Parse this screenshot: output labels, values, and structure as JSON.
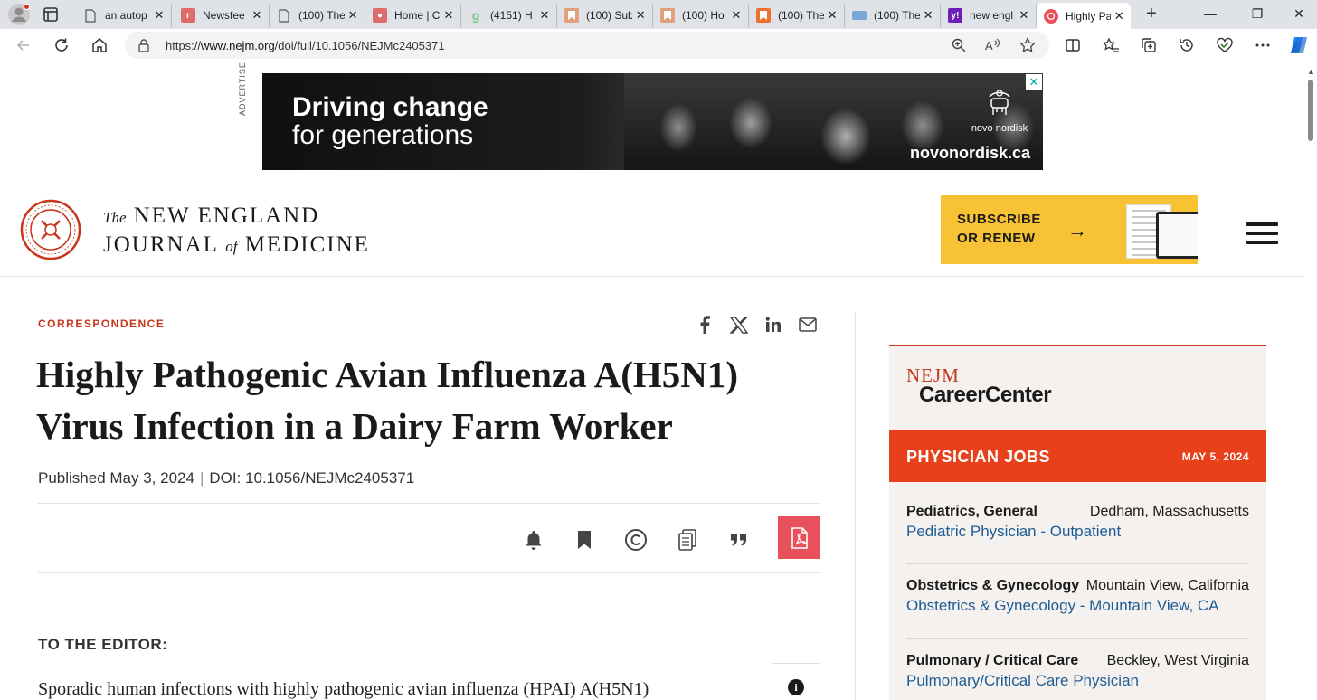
{
  "browser": {
    "tabs": [
      {
        "title": "an autop",
        "favicon": "doc",
        "color": "#ffffff"
      },
      {
        "title": "Newsfee",
        "favicon": "r",
        "color": "#e06b6b"
      },
      {
        "title": "(100) The",
        "favicon": "doc",
        "color": "#ffffff"
      },
      {
        "title": "Home | C",
        "favicon": "user",
        "color": "#e06b6b"
      },
      {
        "title": "(4151) H",
        "favicon": "g",
        "color": "#7bc67e"
      },
      {
        "title": "(100) Sub",
        "favicon": "bookmark",
        "color": "#e0a07b"
      },
      {
        "title": "(100) Ho",
        "favicon": "bookmark",
        "color": "#e0a07b"
      },
      {
        "title": "(100) The",
        "favicon": "bookmark",
        "color": "#f07030"
      },
      {
        "title": "(100) The",
        "favicon": "site",
        "color": "#7aa7d8"
      },
      {
        "title": "new engl",
        "favicon": "y!",
        "color": "#6b1fb8"
      },
      {
        "title": "Highly Pa",
        "favicon": "nejm",
        "color": "#e8505b",
        "active": true
      }
    ],
    "url_prefix": "https://",
    "url_host": "www.nejm.org",
    "url_path": "/doi/full/10.1056/NEJMc2405371"
  },
  "ad": {
    "label": "ADVERTISEMENT",
    "headline_1": "Driving change",
    "headline_2": "for generations",
    "brand": "novo nordisk",
    "site": "novonordisk.ca",
    "close": "✕"
  },
  "masthead": {
    "title_the": "The",
    "title_line1": "NEW ENGLAND",
    "title_journal": "JOURNAL",
    "title_of": "of",
    "title_medicine": "MEDICINE",
    "subscribe_line1": "SUBSCRIBE",
    "subscribe_line2": "OR RENEW",
    "subscribe_arrow": "→"
  },
  "article": {
    "section": "CORRESPONDENCE",
    "title_line1": "Highly Pathogenic Avian Influenza A(H5N1)",
    "title_line2": "Virus Infection in a Dairy Farm Worker",
    "published": "Published May 3, 2024",
    "separator": "|",
    "doi": "DOI: 10.1056/NEJMc2405371",
    "to_editor": "TO THE EDITOR:",
    "body_start": "Sporadic human infections with highly pathogenic avian influenza (HPAI) A(H5N1)",
    "info": "i"
  },
  "sidebar": {
    "logo_nejm": "NEJM",
    "logo_career": "CareerCenter",
    "jobs_title": "PHYSICIAN JOBS",
    "jobs_date": "MAY 5, 2024",
    "jobs": [
      {
        "specialty": "Pediatrics, General",
        "location": "Dedham, Massachusetts",
        "title": "Pediatric Physician - Outpatient"
      },
      {
        "specialty": "Obstetrics & Gynecology",
        "location": "Mountain View, California",
        "title": "Obstetrics & Gynecology - Mountain View, CA"
      },
      {
        "specialty": "Pulmonary / Critical Care",
        "location": "Beckley, West Virginia",
        "title": "Pulmonary/Critical Care Physician"
      }
    ]
  },
  "colors": {
    "nejm_red": "#c8351a",
    "jobs_orange": "#e8401a",
    "pdf_red": "#e8505b",
    "subscribe_yellow": "#f7c233",
    "link_blue": "#1f5d96"
  }
}
